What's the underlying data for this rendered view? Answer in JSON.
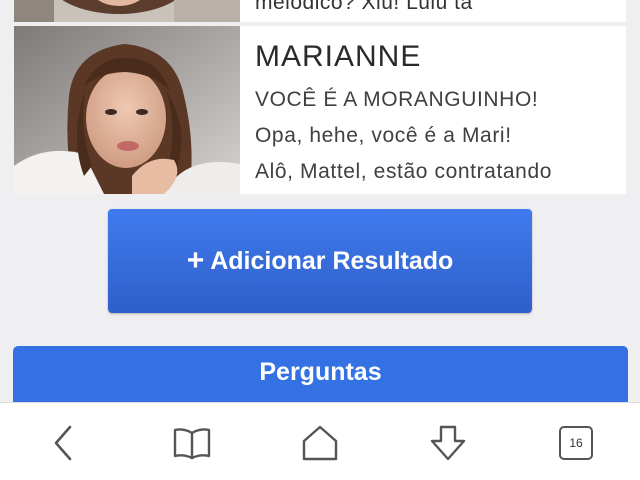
{
  "results": [
    {
      "visible_text": "melódico? Xiu! Lulu tá"
    },
    {
      "title": "MARIANNE",
      "lines": [
        "VOCÊ É A MORANGUINHO!",
        "Opa, hehe, você é a Mari!",
        "Alô, Mattel, estão contratando"
      ]
    }
  ],
  "add_button": {
    "icon": "plus-icon",
    "label": "Adicionar Resultado"
  },
  "section": {
    "title": "Perguntas"
  },
  "browser_toolbar": {
    "tab_count": "16",
    "icons": [
      "back-icon",
      "bookmarks-icon",
      "home-icon",
      "download-icon",
      "tabs-icon"
    ]
  },
  "colors": {
    "button_top": "#3f7bee",
    "button_bottom": "#2f5fc8",
    "section_bar": "#3472e4",
    "background": "#efeff1"
  }
}
